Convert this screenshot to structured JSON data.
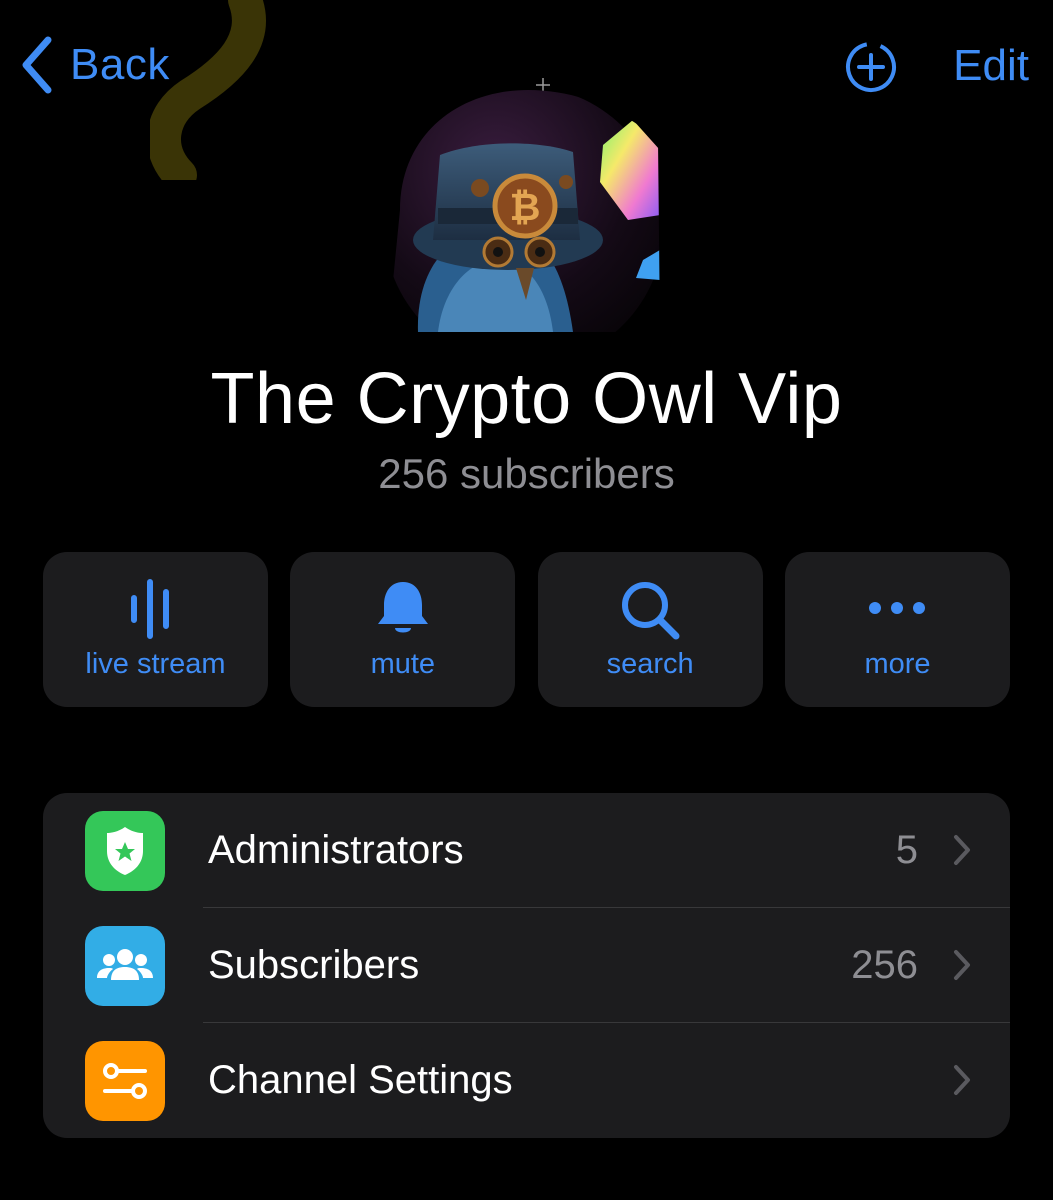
{
  "nav": {
    "back_label": "Back",
    "edit_label": "Edit",
    "add_icon": "add-circle-icon"
  },
  "colors": {
    "accent": "#3f8cf5",
    "background": "#000000",
    "card": "#1c1c1e",
    "secondary_text": "#8e8e93",
    "admin_badge": "#34c759",
    "subscribers_badge": "#32ade6",
    "settings_badge": "#ff9500"
  },
  "channel": {
    "name": "The Crypto Owl Vip",
    "subscribers": "256 subscribers"
  },
  "actions": [
    {
      "label": "live stream",
      "icon": "waveform-icon"
    },
    {
      "label": "mute",
      "icon": "bell-icon"
    },
    {
      "label": "search",
      "icon": "search-icon"
    },
    {
      "label": "more",
      "icon": "ellipsis-icon"
    }
  ],
  "list": [
    {
      "label": "Administrators",
      "value": "5",
      "icon": "shield-star-icon"
    },
    {
      "label": "Subscribers",
      "value": "256",
      "icon": "people-icon"
    },
    {
      "label": "Channel Settings",
      "value": "",
      "icon": "sliders-icon"
    }
  ]
}
